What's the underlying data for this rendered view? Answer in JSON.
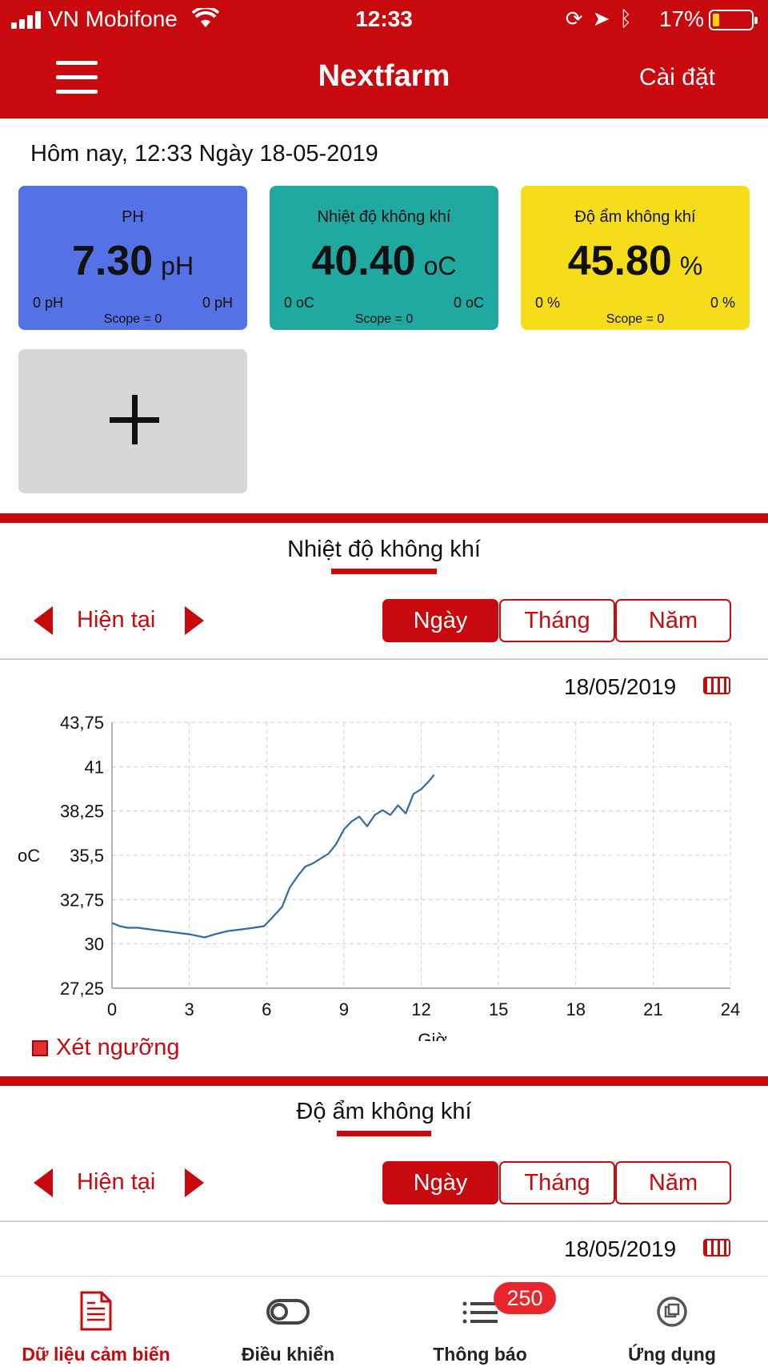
{
  "status_bar": {
    "carrier": "VN Mobifone",
    "time": "12:33",
    "battery_percent": "17%",
    "battery_fraction": 0.17
  },
  "header": {
    "title": "Nextfarm",
    "settings_label": "Cài đặt"
  },
  "today_label": "Hôm nay, 12:33 Ngày 18-05-2019",
  "sensor_cards": [
    {
      "name": "PH",
      "value": "7.30",
      "unit": "pH",
      "min": "0 pH",
      "max": "0 pH",
      "scope": "Scope = 0",
      "color": "#5472e6"
    },
    {
      "name": "Nhiệt độ không khí",
      "value": "40.40",
      "unit": "oC",
      "min": "0 oC",
      "max": "0 oC",
      "scope": "Scope = 0",
      "color": "#20a9a1"
    },
    {
      "name": "Độ ẩm không khí",
      "value": "45.80",
      "unit": "%",
      "min": "0 %",
      "max": "0 %",
      "scope": "Scope = 0",
      "color": "#f5dd1c"
    }
  ],
  "temperature_section": {
    "title": "Nhiệt độ không khí",
    "current_label": "Hiện tại",
    "periods": [
      "Ngày",
      "Tháng",
      "Năm"
    ],
    "active_period": "Ngày",
    "date": "18/05/2019",
    "threshold_label": "Xét ngưỡng"
  },
  "humidity_section": {
    "title": "Độ ẩm không khí",
    "current_label": "Hiện tại",
    "periods": [
      "Ngày",
      "Tháng",
      "Năm"
    ],
    "active_period": "Ngày",
    "date": "18/05/2019"
  },
  "chart_data": {
    "type": "line",
    "xlabel": "Giờ",
    "ylabel": "oC",
    "xlim": [
      0,
      24
    ],
    "ylim": [
      27.25,
      43.75
    ],
    "x_ticks": [
      "0",
      "3",
      "6",
      "9",
      "12",
      "15",
      "18",
      "21",
      "24"
    ],
    "y_ticks": [
      "43,75",
      "41",
      "38,25",
      "35,5",
      "32,75",
      "30",
      "27,25"
    ],
    "grid": true,
    "color": "#2e6aa8",
    "series": [
      {
        "x": [
          0,
          0.3,
          0.6,
          1,
          1.5,
          2,
          2.5,
          3,
          3.3,
          3.6,
          4,
          4.5,
          5,
          5.5,
          5.9,
          6.2,
          6.6,
          6.9,
          7.2,
          7.5,
          7.8,
          8.1,
          8.4,
          8.7,
          9,
          9.3,
          9.6,
          9.9,
          10.2,
          10.5,
          10.8,
          11.1,
          11.4,
          11.7,
          12,
          12.3,
          12.5
        ],
        "y": [
          31.3,
          31.1,
          31.0,
          31.0,
          30.9,
          30.8,
          30.7,
          30.6,
          30.5,
          30.4,
          30.6,
          30.8,
          30.9,
          31.0,
          31.1,
          31.6,
          32.3,
          33.5,
          34.2,
          34.8,
          35.0,
          35.3,
          35.6,
          36.2,
          37.1,
          37.6,
          37.9,
          37.3,
          38.0,
          38.3,
          38.0,
          38.6,
          38.1,
          39.3,
          39.6,
          40.1,
          40.5
        ]
      }
    ]
  },
  "tabbar": {
    "items": [
      {
        "label": "Dữ liệu cảm biến",
        "active": true
      },
      {
        "label": "Điều khiển",
        "active": false
      },
      {
        "label": "Thông báo",
        "active": false
      },
      {
        "label": "Ứng dụng",
        "active": false
      }
    ],
    "notification_count": "250"
  }
}
